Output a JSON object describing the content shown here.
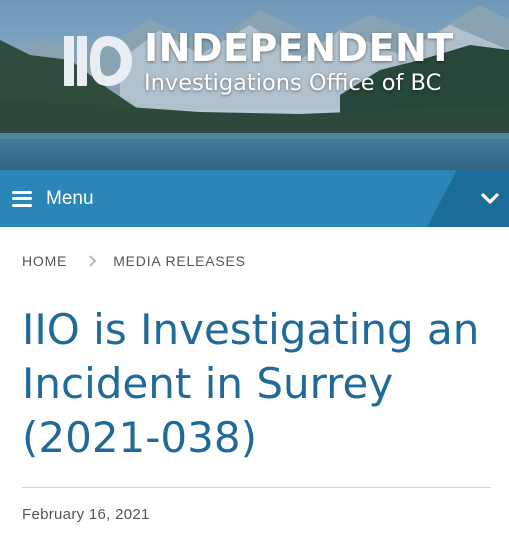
{
  "header": {
    "logo_title": "INDEPENDENT",
    "logo_subtitle": "Investigations Office of BC"
  },
  "nav": {
    "menu_label": "Menu",
    "menu_icon": "hamburger-icon",
    "expand_icon": "chevron-down-icon"
  },
  "breadcrumb": {
    "items": [
      "HOME",
      "MEDIA RELEASES"
    ],
    "separator_icon": "chevron-right-icon"
  },
  "article": {
    "title": "IIO is Investigating an Incident in Surrey (2021-038)",
    "date": "February 16, 2021"
  },
  "colors": {
    "menu_bar": "#2b86b8",
    "menu_bar_dark": "#1d6c98",
    "title": "#1f6a99",
    "breadcrumb_text": "#555555"
  }
}
